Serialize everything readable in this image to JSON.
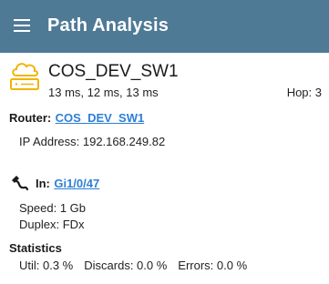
{
  "app": {
    "title": "Path Analysis",
    "menu_icon": "hamburger-menu-icon",
    "appbar_color": "#4f7a96"
  },
  "device": {
    "icon": "cloud-switch-icon",
    "icon_color": "#f0b400",
    "name": "COS_DEV_SW1",
    "latency": "13 ms,  12 ms,  13 ms",
    "hop": "Hop: 3"
  },
  "router": {
    "label": "Router:",
    "link": "COS_DEV_SW1",
    "ip": "IP Address: 192.168.249.82"
  },
  "interface": {
    "icon": "ethernet-cable-icon",
    "label": "In:",
    "link": "Gi1/0/47",
    "speed": "Speed: 1 Gb",
    "duplex": "Duplex: FDx"
  },
  "statistics": {
    "heading": "Statistics",
    "util": "Util: 0.3 %",
    "discards": "Discards: 0.0 %",
    "errors": "Errors: 0.0 %"
  },
  "colors": {
    "link": "#2e7fd6"
  }
}
